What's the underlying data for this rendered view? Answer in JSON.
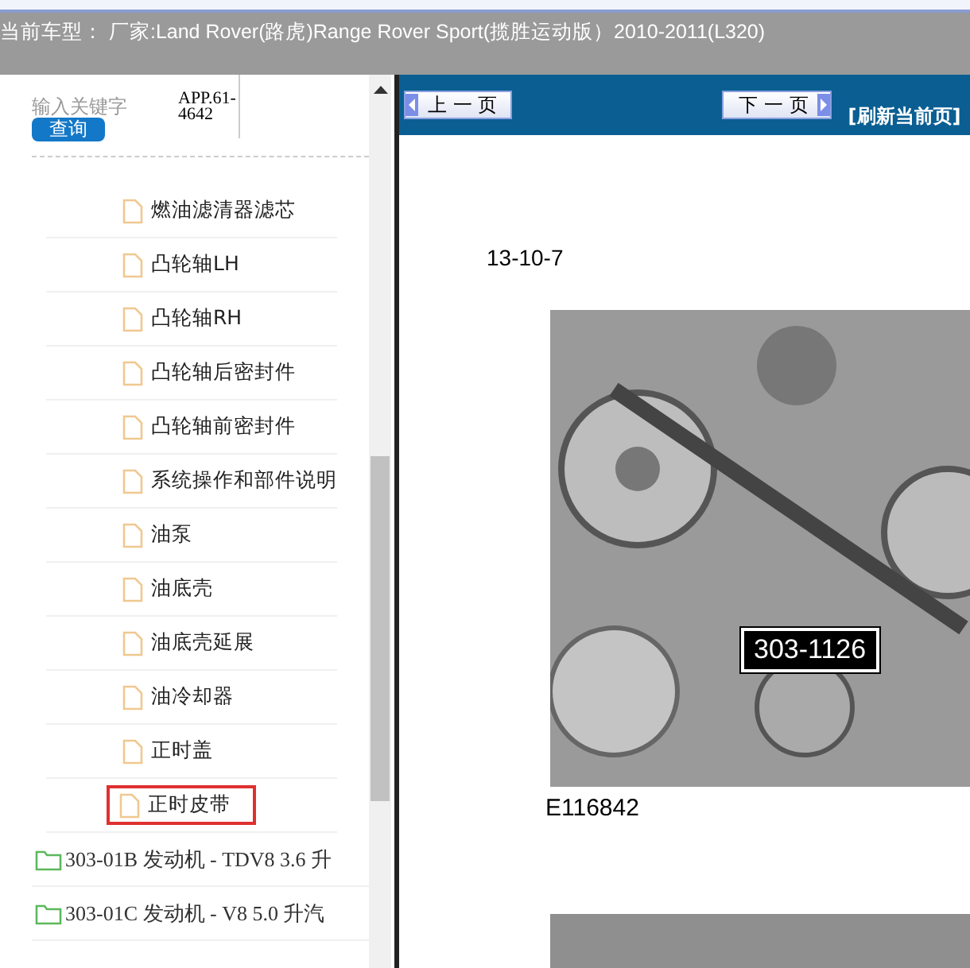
{
  "header": {
    "title": "当前车型： 厂家:Land Rover(路虎)Range Rover Sport(揽胜运动版）2010-2011(L320)"
  },
  "search": {
    "placeholder": "输入关键字",
    "button": "查询",
    "code": "APP.61-\n4642"
  },
  "tree": [
    {
      "kind": "file",
      "label": "燃油滤清器滤芯",
      "selected": false
    },
    {
      "kind": "file",
      "label": "凸轮轴LH",
      "selected": false
    },
    {
      "kind": "file",
      "label": "凸轮轴RH",
      "selected": false
    },
    {
      "kind": "file",
      "label": "凸轮轴后密封件",
      "selected": false
    },
    {
      "kind": "file",
      "label": "凸轮轴前密封件",
      "selected": false
    },
    {
      "kind": "file",
      "label": "系统操作和部件说明",
      "selected": false
    },
    {
      "kind": "file",
      "label": "油泵",
      "selected": false
    },
    {
      "kind": "file",
      "label": "油底壳",
      "selected": false
    },
    {
      "kind": "file",
      "label": "油底壳延展",
      "selected": false
    },
    {
      "kind": "file",
      "label": "油冷却器",
      "selected": false
    },
    {
      "kind": "file",
      "label": "正时盖",
      "selected": false
    },
    {
      "kind": "file",
      "label": "正时皮带",
      "selected": true
    },
    {
      "kind": "folder",
      "label": "303-01B 发动机 - TDV8 3.6 升",
      "selected": false
    },
    {
      "kind": "folder",
      "label": "303-01C 发动机 - V8 5.0 升汽",
      "selected": false
    }
  ],
  "toolbar": {
    "prev": "上 一 页",
    "next": "下 一 页",
    "refresh": "[刷新当前页]"
  },
  "document": {
    "page_ref": "13-10-7",
    "callout": "303-1126",
    "figure_id": "E116842"
  }
}
